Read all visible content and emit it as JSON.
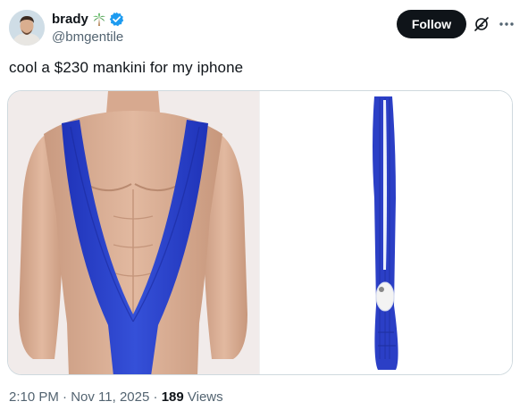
{
  "author": {
    "display_name": "brady",
    "handle": "@bmgentile",
    "emoji_icon": "palm-tree-icon",
    "verified_icon": "verified-badge-icon",
    "verified_color": "#1d9bf0"
  },
  "actions": {
    "follow_label": "Follow",
    "grok_icon": "grok-icon",
    "more_icon": "more-icon"
  },
  "tweet": {
    "text": "cool a $230 mankini for my iphone"
  },
  "media": {
    "images": [
      "mannequin-wearing-blue-mankini",
      "blue-mankini-phone-case"
    ],
    "product_color": "#2b3fc6"
  },
  "meta": {
    "time": "2:10 PM",
    "separator1": " · ",
    "date": "Nov 11, 2025",
    "separator2": " · ",
    "views_count": "189",
    "views_label": " Views"
  }
}
